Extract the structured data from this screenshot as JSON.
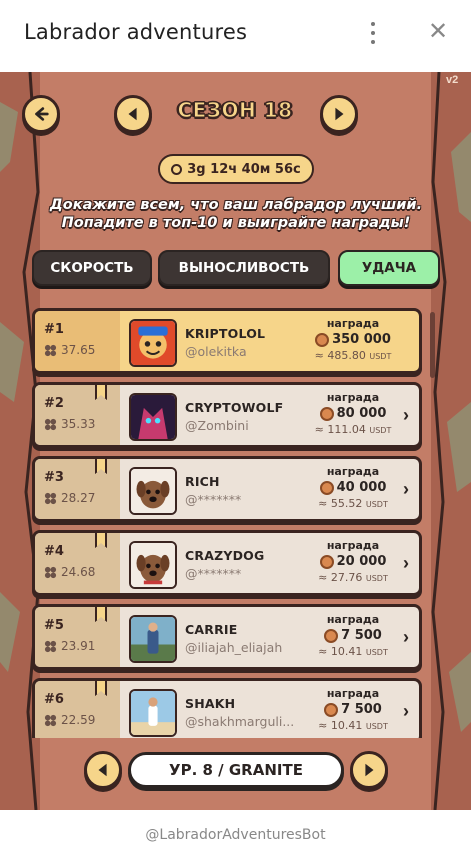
{
  "window": {
    "title": "Labrador adventures"
  },
  "game": {
    "version": "v2",
    "season": "СЕЗОН 18",
    "timer": "3g 12ч 40м 56c",
    "tagline_line1": "Докажите всем, что ваш лабрадор лучший.",
    "tagline_line2": "Попадите в топ-10 и выиграйте награды!",
    "tabs": [
      {
        "label": "СКОРОСТЬ",
        "active": false
      },
      {
        "label": "ВЫНОСЛИВОСТЬ",
        "active": false
      },
      {
        "label": "УДАЧА",
        "active": true
      }
    ],
    "reward_label": "награда",
    "usd_unit": "USDT",
    "leaderboard": [
      {
        "rank": "#1",
        "score": "37.65",
        "name": "KRIPTOLOL",
        "handle": "@olekitka",
        "reward": "350 000",
        "usd": "≈ 485.80"
      },
      {
        "rank": "#2",
        "score": "35.33",
        "name": "CRYPTOWOLF",
        "handle": "@Zombini",
        "reward": "80 000",
        "usd": "≈ 111.04"
      },
      {
        "rank": "#3",
        "score": "28.27",
        "name": "RICH",
        "handle": "@*******",
        "reward": "40 000",
        "usd": "≈ 55.52"
      },
      {
        "rank": "#4",
        "score": "24.68",
        "name": "CRAZYDOG",
        "handle": "@*******",
        "reward": "20 000",
        "usd": "≈ 27.76"
      },
      {
        "rank": "#5",
        "score": "23.91",
        "name": "CARRIE",
        "handle": "@iliajah_eliajah",
        "reward": "7 500",
        "usd": "≈ 10.41"
      },
      {
        "rank": "#6",
        "score": "22.59",
        "name": "SHAKH",
        "handle": "@shakhmarguli...",
        "reward": "7 500",
        "usd": "≈ 10.41"
      }
    ],
    "level": "УР. 8 / GRANITE",
    "colors": {
      "accent": "#f6d58a",
      "active_tab": "#9cf0a8",
      "panel": "#b97560",
      "outline": "#3a2420"
    }
  },
  "footer": {
    "bot": "@LabradorAdventuresBot"
  }
}
